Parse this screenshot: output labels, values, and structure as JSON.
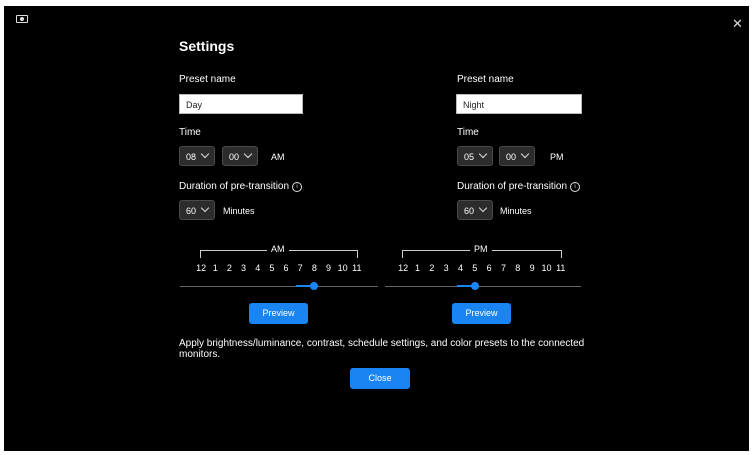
{
  "window": {
    "close_glyph": "✕",
    "app_icon": "monitor-settings-icon"
  },
  "title": "Settings",
  "day": {
    "preset_label": "Preset name",
    "preset_value": "Day",
    "time_label": "Time",
    "hour": "08",
    "minute": "00",
    "period": "AM",
    "duration_label": "Duration of pre-transition",
    "duration_value": "60",
    "duration_unit": "Minutes",
    "timeline_label": "AM",
    "ticks": [
      "12",
      "1",
      "2",
      "3",
      "4",
      "5",
      "6",
      "7",
      "8",
      "9",
      "10",
      "11"
    ],
    "slider_hour": 8,
    "preview_label": "Preview"
  },
  "night": {
    "preset_label": "Preset name",
    "preset_value": "Night",
    "time_label": "Time",
    "hour": "05",
    "minute": "00",
    "period": "PM",
    "duration_label": "Duration of pre-transition",
    "duration_value": "60",
    "duration_unit": "Minutes",
    "timeline_label": "PM",
    "ticks": [
      "12",
      "1",
      "2",
      "3",
      "4",
      "5",
      "6",
      "7",
      "8",
      "9",
      "10",
      "11"
    ],
    "slider_hour": 5,
    "preview_label": "Preview"
  },
  "info_glyph": "i",
  "footer_text": "Apply brightness/luminance, contrast, schedule settings, and color presets to the connected monitors.",
  "close_label": "Close",
  "colors": {
    "accent": "#1a84f2",
    "background": "#000000"
  }
}
